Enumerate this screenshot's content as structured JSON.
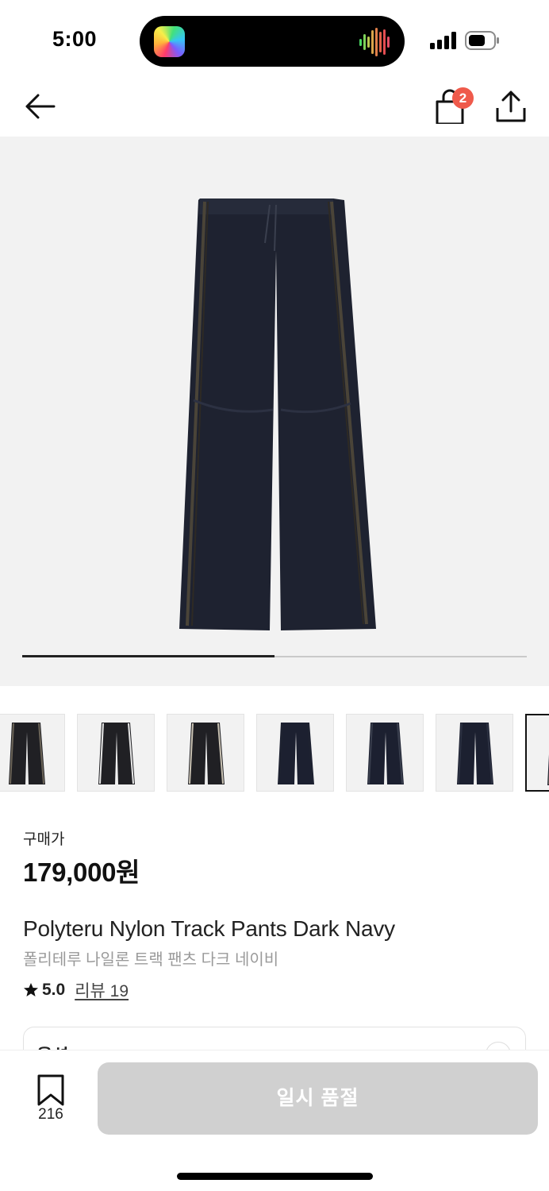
{
  "status_bar": {
    "time": "5:00",
    "icons": [
      "app-icon",
      "audio-wave-icon",
      "cellular-signal-icon",
      "battery-icon"
    ]
  },
  "nav": {
    "icons": [
      "back-arrow-icon",
      "shopping-bag-icon",
      "share-icon"
    ],
    "cart_badge": "2"
  },
  "gallery": {
    "progress": 0.5,
    "thumbnail_count": 7,
    "selected_thumbnail": 6
  },
  "product": {
    "price_label": "구매가",
    "price": "179,000원",
    "name_en": "Polyteru Nylon Track Pants Dark Navy",
    "name_ko": "폴리테루 나일론 트랙 팬츠 다크 네이비",
    "rating": "5.0",
    "review_link": "리뷰 19"
  },
  "option": {
    "label": "옵션"
  },
  "bottom_bar": {
    "bookmark_count": "216",
    "cta_label": "일시 품절"
  },
  "colors": {
    "badge": "#ef5a4b",
    "cta_disabled": "#d0d0d0",
    "hero_bg": "#f2f2f2"
  }
}
